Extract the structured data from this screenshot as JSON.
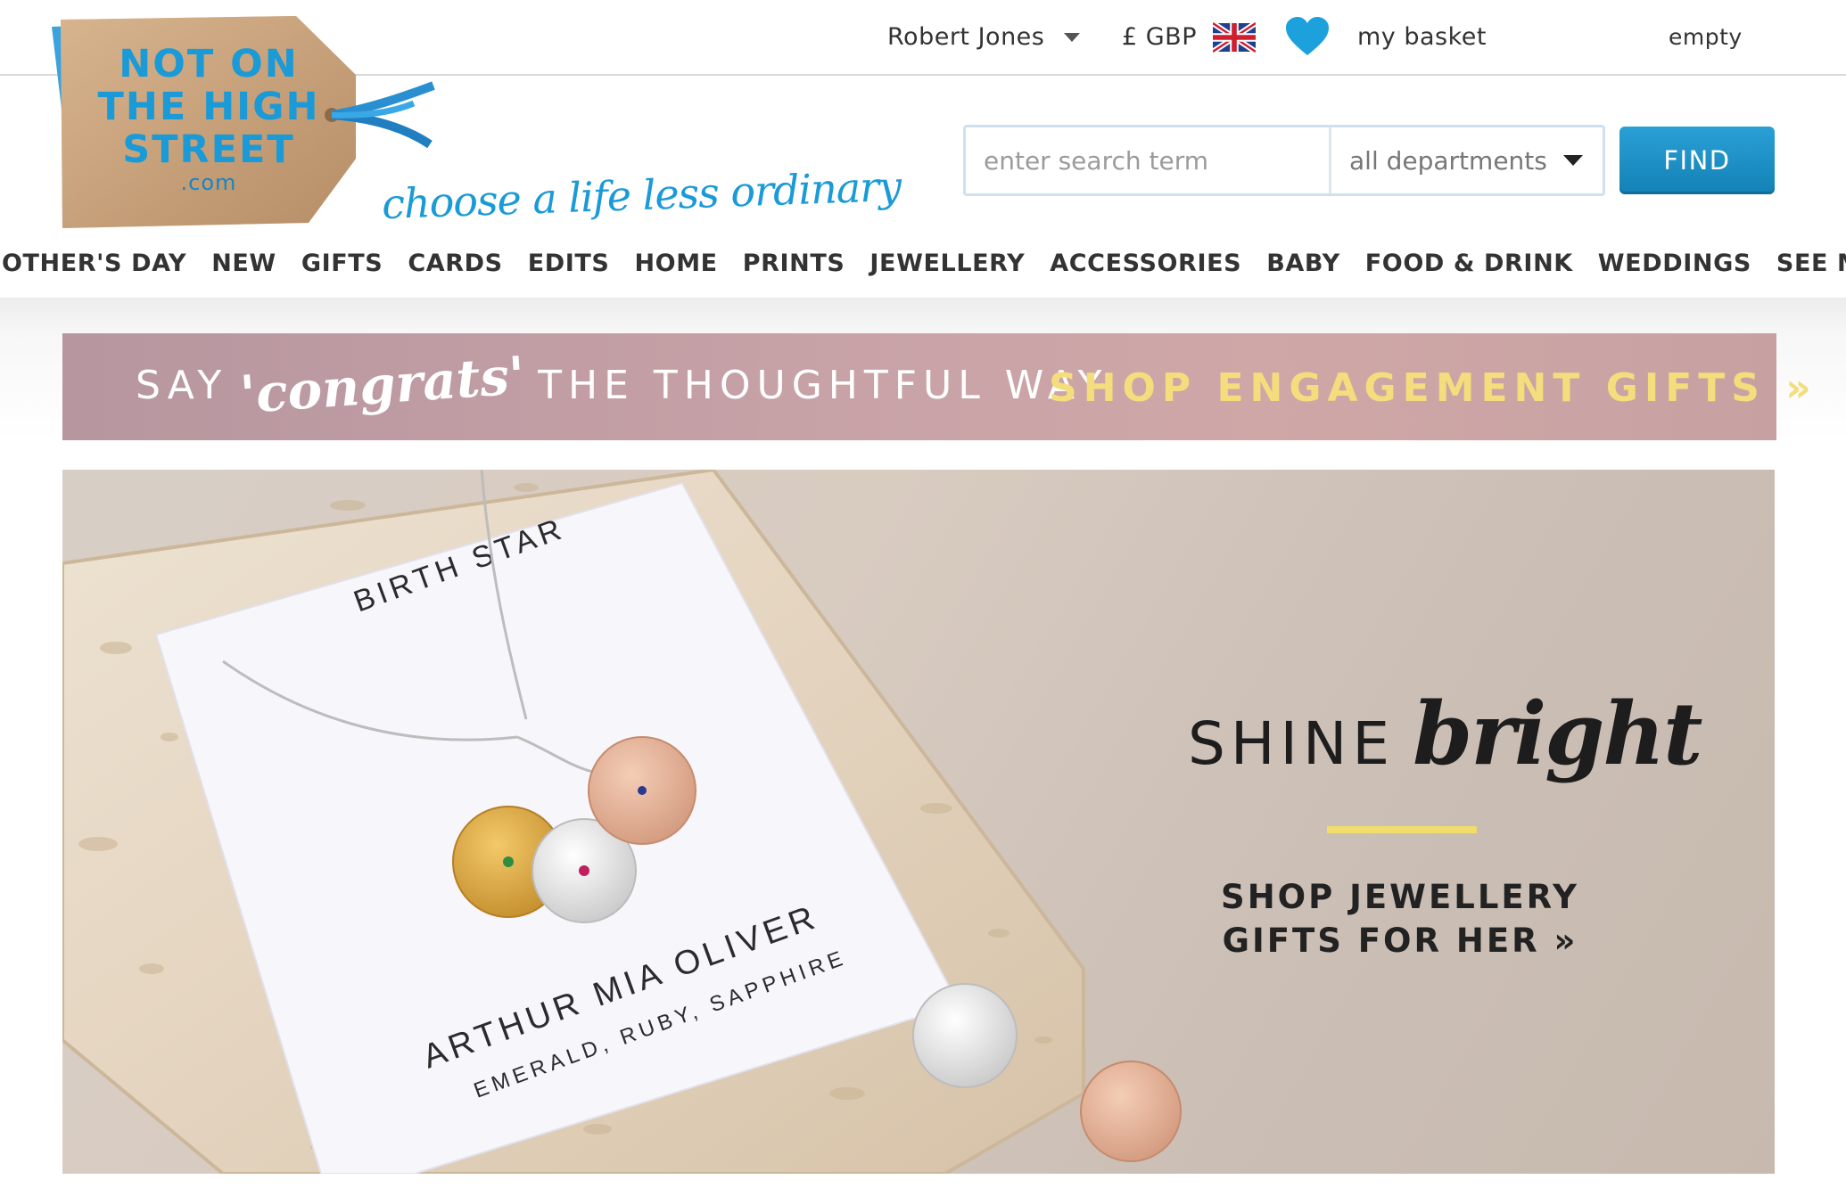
{
  "header": {
    "user_name": "Robert Jones",
    "currency": "£ GBP",
    "basket_label": "my basket",
    "basket_status": "empty"
  },
  "logo": {
    "line1": "NOT ON",
    "line2": "THE HIGH",
    "line3": "STREET",
    "line4": ".com",
    "tagline": "choose a life less ordinary"
  },
  "search": {
    "placeholder": "enter search term",
    "department": "all departments",
    "button_label": "FIND"
  },
  "nav": {
    "items": [
      "MOTHER'S DAY",
      "NEW",
      "GIFTS",
      "CARDS",
      "EDITS",
      "HOME",
      "PRINTS",
      "JEWELLERY",
      "ACCESSORIES",
      "BABY",
      "FOOD & DRINK",
      "WEDDINGS",
      "SEE MORE"
    ]
  },
  "promo": {
    "lead_a": "SAY",
    "lead_script": "'congrats'",
    "lead_b": "THE THOUGHTFUL WAY",
    "cta": "SHOP ENGAGEMENT GIFTS »"
  },
  "hero": {
    "title_caps": "SHINE",
    "title_script": "bright",
    "cta_line1": "SHOP JEWELLERY",
    "cta_line2": "GIFTS FOR HER »",
    "card": {
      "heading": "BIRTH STAR",
      "names": "ARTHUR   MIA   OLIVER",
      "stones": "EMERALD, RUBY, SAPPHIRE"
    }
  },
  "colors": {
    "brand_blue": "#1a9ad6",
    "find_button": "#1a8cc4",
    "promo_bg": "#c6a1a6",
    "promo_cta": "#f3dd7c",
    "hero_rule": "#f0dd6b"
  },
  "icons": {
    "user_caret": "chevron-down-icon",
    "flag": "uk-flag-icon",
    "wishlist": "heart-icon",
    "department_caret": "caret-down-icon"
  }
}
